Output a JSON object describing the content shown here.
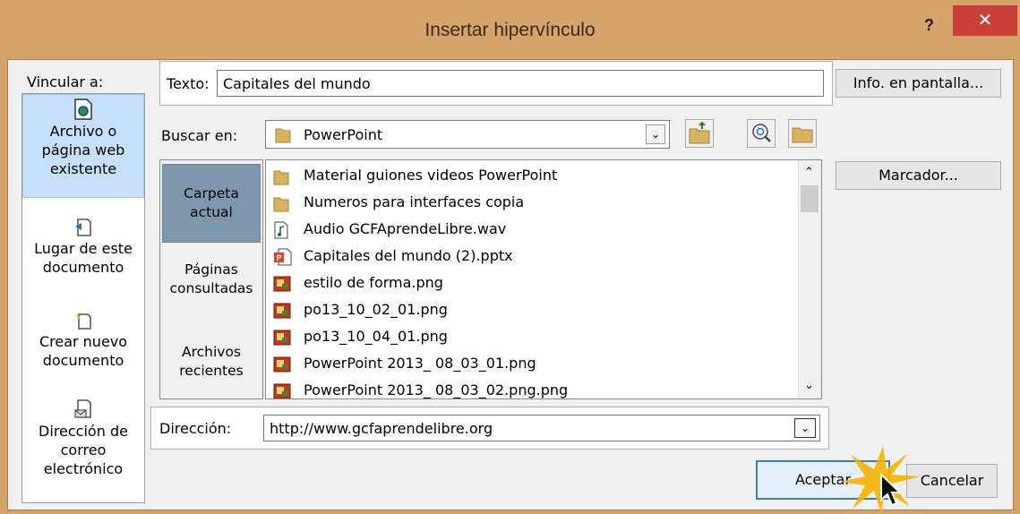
{
  "window": {
    "title": "Insertar hipervínculo",
    "help_label": "?",
    "close_label": "✕"
  },
  "link_to": {
    "label": "Vincular a:",
    "items": [
      {
        "line1": "Archivo o",
        "line2": "página web",
        "line3": "existente",
        "icon": "file-web-icon"
      },
      {
        "line1": "Lugar de este",
        "line2": "documento",
        "icon": "document-place-icon"
      },
      {
        "line1": "Crear nuevo",
        "line2": "documento",
        "icon": "new-document-icon"
      },
      {
        "line1": "Dirección de",
        "line2": "correo",
        "line3": "electrónico",
        "icon": "email-icon"
      }
    ]
  },
  "text_field": {
    "label": "Texto:",
    "value": "Capitales del mundo"
  },
  "screentip_button": "Info. en pantalla...",
  "look_in": {
    "label": "Buscar en:",
    "value": "PowerPoint"
  },
  "nav": {
    "items": [
      {
        "line1": "Carpeta",
        "line2": "actual"
      },
      {
        "line1": "Páginas",
        "line2": "consultadas"
      },
      {
        "line1": "Archivos",
        "line2": "recientes"
      }
    ]
  },
  "files": [
    {
      "name": "Material guiones videos PowerPoint",
      "type": "folder"
    },
    {
      "name": "Numeros para interfaces  copia",
      "type": "folder"
    },
    {
      "name": "Audio GCFAprendeLibre.wav",
      "type": "audio"
    },
    {
      "name": "Capitales del mundo (2).pptx",
      "type": "pptx"
    },
    {
      "name": "estilo de forma.png",
      "type": "png"
    },
    {
      "name": "po13_10_02_01.png",
      "type": "png"
    },
    {
      "name": "po13_10_04_01.png",
      "type": "png"
    },
    {
      "name": "PowerPoint 2013_ 08_03_01.png",
      "type": "png"
    },
    {
      "name": "PowerPoint 2013_ 08_03_02.png.png",
      "type": "png"
    }
  ],
  "bookmark_button": "Marcador...",
  "address": {
    "label": "Dirección:",
    "value": "http://www.gcfaprendelibre.org"
  },
  "ok_button": "Aceptar",
  "cancel_button": "Cancelar",
  "colors": {
    "title_bar": "#d4a46a",
    "close_button": "#c9403b",
    "selected_link": "#c5e0f8",
    "selected_nav": "#7e97ad"
  }
}
